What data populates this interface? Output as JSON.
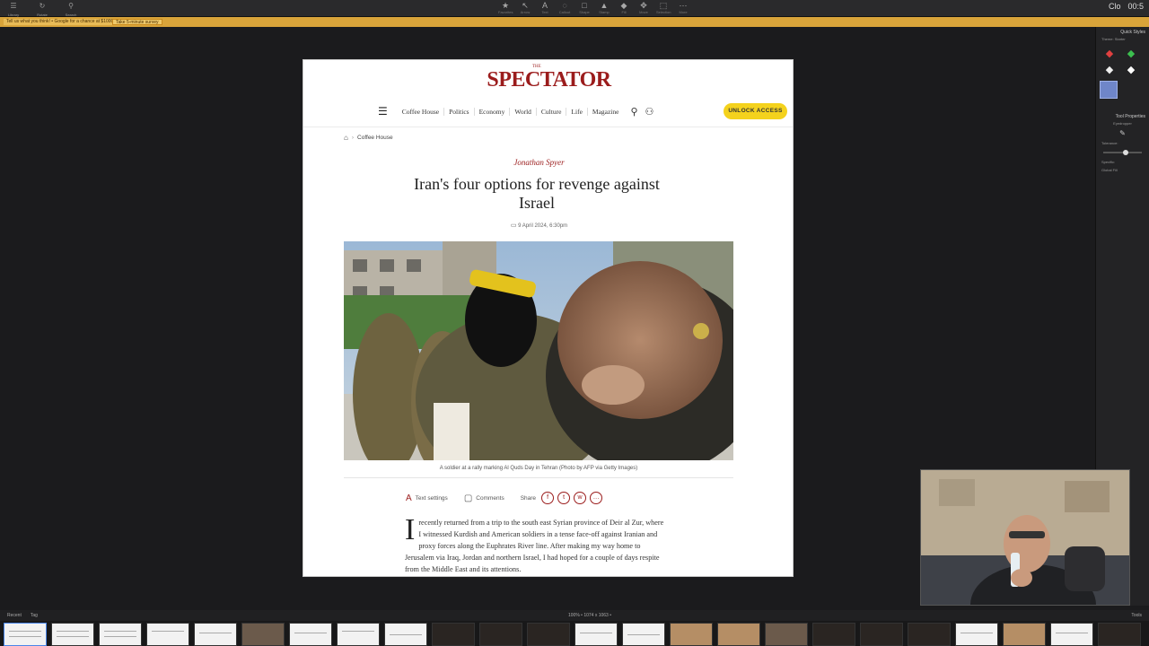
{
  "top_toolbar": {
    "left_buttons": [
      "Library",
      "Rotate",
      "Search"
    ],
    "tools": [
      {
        "icon": "favorites-icon",
        "label": "Favorites"
      },
      {
        "icon": "arrow-icon",
        "label": "Arrow"
      },
      {
        "icon": "text-icon",
        "label": "Text"
      },
      {
        "icon": "callout-icon",
        "label": "Callout"
      },
      {
        "icon": "shape-icon",
        "label": "Shape"
      },
      {
        "icon": "stamp-icon",
        "label": "Stamp"
      },
      {
        "icon": "fill-icon",
        "label": "Fill"
      },
      {
        "icon": "move-icon",
        "label": "Move"
      },
      {
        "icon": "selection-icon",
        "label": "Selection"
      },
      {
        "icon": "more-icon",
        "label": "More"
      }
    ],
    "clock": "00:5",
    "account": "Clo"
  },
  "banner": {
    "message": "Tell us what you think! • Google for a chance at $1000!",
    "button": "Take 5-minute survey"
  },
  "right_panel": {
    "title": "Quick Styles",
    "theme_label": "Theme:",
    "theme_value": "Starter",
    "tool_props": "Tool Properties",
    "eyedropper": "Eyedropper",
    "tolerance": "Tolerance:",
    "specific": "Specific:",
    "global_fill": "Global Fill"
  },
  "article": {
    "logo": "SPECTATOR",
    "logo_small": "THE",
    "nav": [
      "Coffee House",
      "Politics",
      "Economy",
      "World",
      "Culture",
      "Life",
      "Magazine"
    ],
    "unlock": "UNLOCK ACCESS",
    "breadcrumb": "Coffee House",
    "author": "Jonathan Spyer",
    "headline": "Iran's four options for revenge against Israel",
    "date": "9 April 2024, 6:30pm",
    "caption": "A soldier at a rally marking Al Quds Day in Tehran (Photo by AFP via Getty Images)",
    "text_settings": "Text settings",
    "comments": "Comments",
    "share": "Share",
    "dropcap": "I",
    "body": "recently returned from a trip to the south east Syrian province of Deir al Zur, where I witnessed Kurdish and American soldiers in a tense face-off against Iranian and proxy forces along the Euphrates River line. After making my way home to Jerusalem via Iraq, Jordan and northern Israel, I had hoped for a couple of days respite from the Middle East and its attentions."
  },
  "bottom_status": {
    "recent": "Recent",
    "tag": "Tag",
    "zoom": "100% • 1074 x 1063 •",
    "right": "Tools"
  },
  "colors": {
    "brand_red": "#9b1c1c",
    "unlock_yellow": "#f4d21d",
    "banner_gold": "#d9a43a"
  }
}
